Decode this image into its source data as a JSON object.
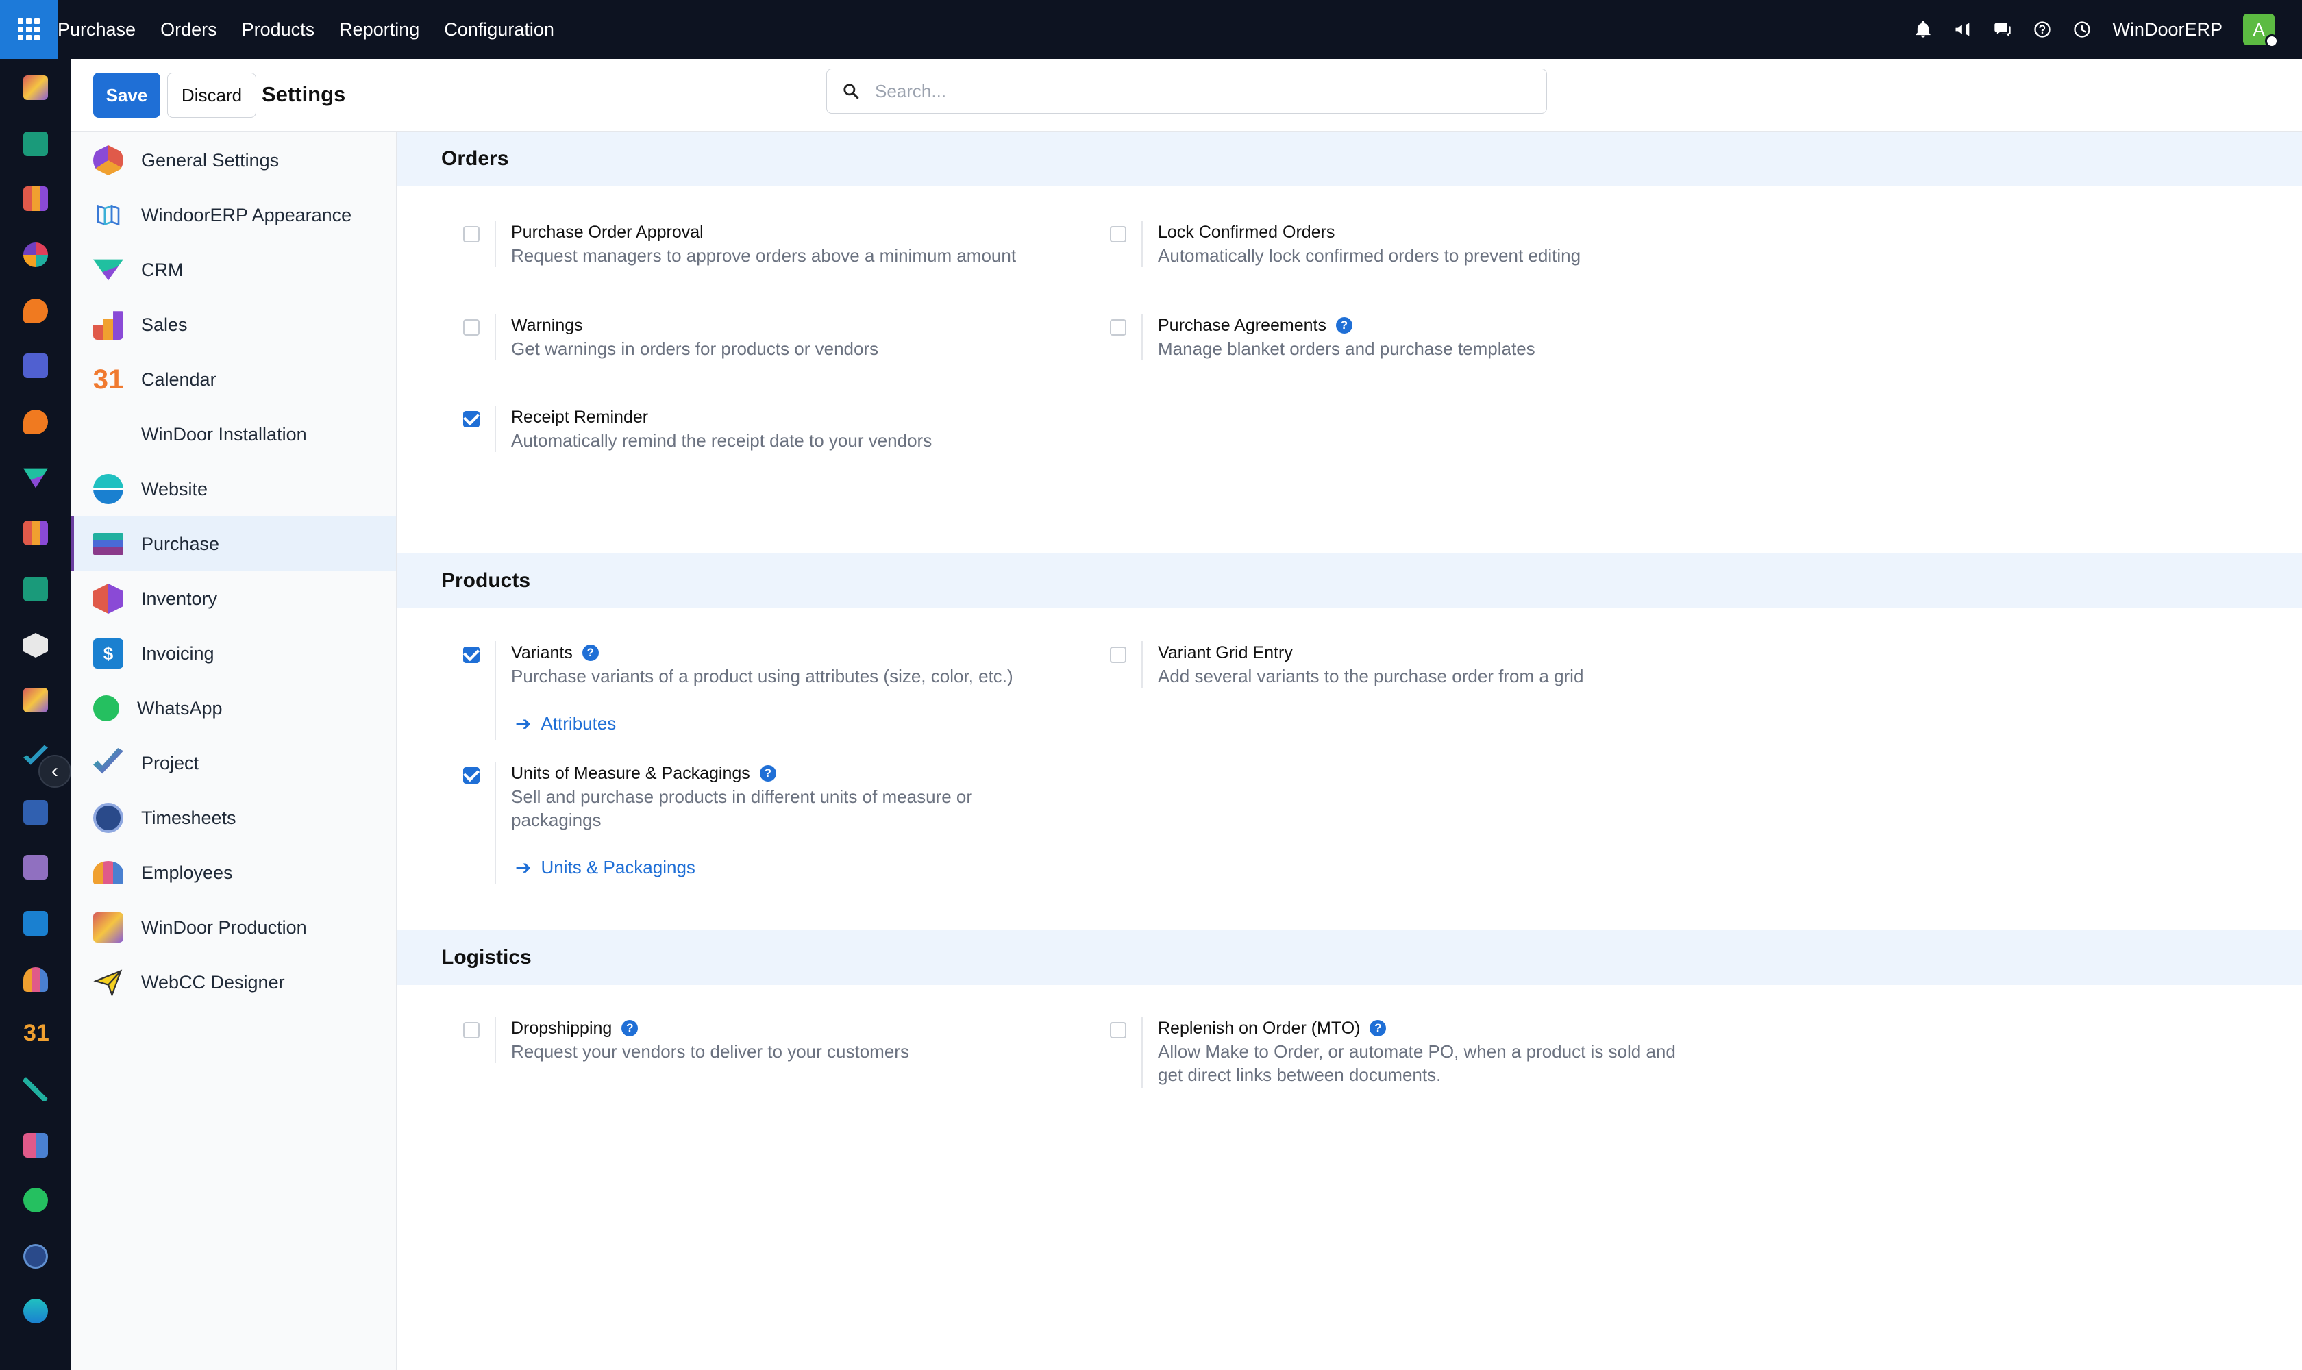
{
  "topbar": {
    "menu": [
      "Purchase",
      "Orders",
      "Products",
      "Reporting",
      "Configuration"
    ],
    "company": "WinDoorERP",
    "avatar_letter": "A"
  },
  "controls": {
    "save_label": "Save",
    "discard_label": "Discard",
    "title": "Settings",
    "search_placeholder": "Search..."
  },
  "sidebar": {
    "items": [
      {
        "label": "General Settings",
        "icon": "general-settings-icon"
      },
      {
        "label": "WindoorERP Appearance",
        "icon": "appearance-icon"
      },
      {
        "label": "CRM",
        "icon": "crm-icon"
      },
      {
        "label": "Sales",
        "icon": "sales-icon"
      },
      {
        "label": "Calendar",
        "icon": "calendar-icon"
      },
      {
        "label": "WinDoor Installation",
        "icon": ""
      },
      {
        "label": "Website",
        "icon": "website-icon"
      },
      {
        "label": "Purchase",
        "icon": "purchase-icon",
        "active": true
      },
      {
        "label": "Inventory",
        "icon": "inventory-icon"
      },
      {
        "label": "Invoicing",
        "icon": "invoicing-icon"
      },
      {
        "label": "WhatsApp",
        "icon": "whatsapp-icon"
      },
      {
        "label": "Project",
        "icon": "project-icon"
      },
      {
        "label": "Timesheets",
        "icon": "timesheets-icon"
      },
      {
        "label": "Employees",
        "icon": "employees-icon"
      },
      {
        "label": "WinDoor Production",
        "icon": "production-icon"
      },
      {
        "label": "WebCC Designer",
        "icon": "designer-icon"
      }
    ]
  },
  "sections": {
    "orders": {
      "title": "Orders",
      "settings": [
        {
          "label": "Purchase Order Approval",
          "desc": "Request managers to approve orders above a minimum amount",
          "checked": false
        },
        {
          "label": "Lock Confirmed Orders",
          "desc": "Automatically lock confirmed orders to prevent editing",
          "checked": false
        },
        {
          "label": "Warnings",
          "desc": "Get warnings in orders for products or vendors",
          "checked": false
        },
        {
          "label": "Purchase Agreements",
          "desc": "Manage blanket orders and purchase templates",
          "checked": false
        },
        {
          "label": "Receipt Reminder",
          "desc": "Automatically remind the receipt date to your vendors",
          "checked": true
        }
      ]
    },
    "products": {
      "title": "Products",
      "settings": [
        {
          "label": "Variants",
          "desc": "Purchase variants of a product using attributes (size, color, etc.)",
          "checked": true,
          "link": "Attributes"
        },
        {
          "label": "Variant Grid Entry",
          "desc": "Add several variants to the purchase order from a grid",
          "checked": false
        },
        {
          "label": "Units of Measure & Packagings",
          "desc": "Sell and purchase products in different units of measure or packagings",
          "checked": true,
          "link": "Units & Packagings"
        }
      ]
    },
    "logistics": {
      "title": "Logistics",
      "settings": [
        {
          "label": "Dropshipping",
          "desc": "Request your vendors to deliver to your customers",
          "checked": false
        },
        {
          "label": "Replenish on Order (MTO)",
          "desc": "Allow Make to Order, or automate PO, when a product is sold and get direct links between documents.",
          "checked": false
        }
      ]
    }
  },
  "colors": {
    "topbar_bg": "#0d1321",
    "accent": "#1f6fd6",
    "section_bg": "#edf4fd"
  }
}
